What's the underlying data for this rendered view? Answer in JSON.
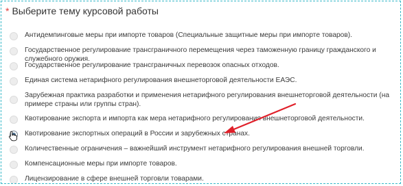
{
  "question": {
    "required_mark": "*",
    "title": "Выберите тему курсовой работы"
  },
  "options": [
    {
      "label": "Антидемпинговые меры при импорте товаров (Специальные защитные меры при импорте товаров).",
      "selected": false
    },
    {
      "label": "Государственное регулирование трансграничного перемещения через таможенную границу гражданского и служебного оружия.",
      "selected": false
    },
    {
      "label": "Государственное регулирование трансграничных перевозок опасных отходов.",
      "selected": false
    },
    {
      "label": "Единая система нетарифного регулирования внешнеторговой деятельности ЕАЭС.",
      "selected": false
    },
    {
      "label": "Зарубежная практика разработки и применения нетарифного регулирования внешнеторговой деятельности (на примере страны или группы стран).",
      "selected": false
    },
    {
      "label": "Квотирование экспорта и импорта как мера нетарифного регулирования внешнеторговой деятельности.",
      "selected": false
    },
    {
      "label": "Квотирование экспортных операций в России и зарубежных странах.",
      "selected": true
    },
    {
      "label": "Количественные ограничения – важнейший инструмент нетарифного регулирования внешней торговли.",
      "selected": false
    },
    {
      "label": "Компенсационные меры при импорте товаров.",
      "selected": false
    },
    {
      "label": "Лицензирование в сфере внешней торговли товарами.",
      "selected": false
    }
  ],
  "colors": {
    "accent_arrow": "#e0202a",
    "required": "#e03a3a",
    "frame_border": "#35b8c8"
  }
}
